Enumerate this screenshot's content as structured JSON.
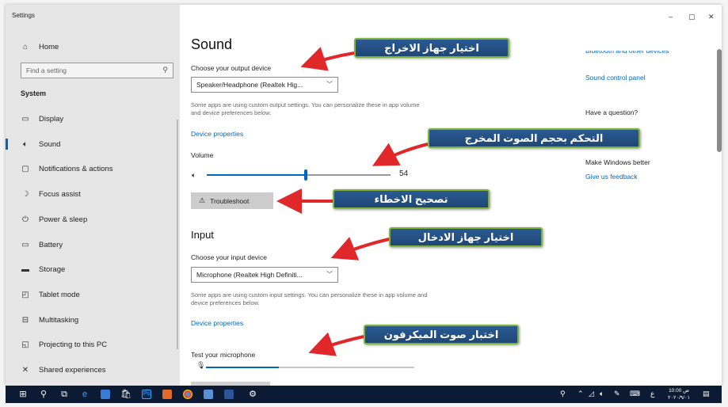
{
  "window": {
    "title": "Settings",
    "controls": {
      "minimize": "–",
      "maximize": "▢",
      "close": "✕"
    }
  },
  "sidebar": {
    "home": "Home",
    "search_placeholder": "Find a setting",
    "section": "System",
    "items": [
      {
        "label": "Display",
        "icon": "display-icon"
      },
      {
        "label": "Sound",
        "icon": "speaker-icon",
        "active": true
      },
      {
        "label": "Notifications & actions",
        "icon": "notification-icon"
      },
      {
        "label": "Focus assist",
        "icon": "moon-icon"
      },
      {
        "label": "Power & sleep",
        "icon": "power-icon"
      },
      {
        "label": "Battery",
        "icon": "battery-icon"
      },
      {
        "label": "Storage",
        "icon": "storage-icon"
      },
      {
        "label": "Tablet mode",
        "icon": "tablet-icon"
      },
      {
        "label": "Multitasking",
        "icon": "multitasking-icon"
      },
      {
        "label": "Projecting to this PC",
        "icon": "projector-icon"
      },
      {
        "label": "Shared experiences",
        "icon": "shared-icon"
      }
    ]
  },
  "main": {
    "title": "Sound",
    "output": {
      "label": "Choose your output device",
      "device": "Speaker/Headphone (Realtek Hig...",
      "note": "Some apps are using custom output settings. You can personalize these in app volume and device preferences below.",
      "properties_link": "Device properties",
      "volume_label": "Volume",
      "volume_value": "54",
      "volume_fraction": 0.54,
      "troubleshoot": "Troubleshoot"
    },
    "input": {
      "heading": "Input",
      "label": "Choose your input device",
      "device": "Microphone (Realtek High Definiti...",
      "note": "Some apps are using custom input settings. You can personalize these in app volume and device preferences below.",
      "properties_link": "Device properties",
      "test_label": "Test your microphone",
      "mic_level_fraction": 0.35
    }
  },
  "related": {
    "cut_link": "Bluetooth and other devices",
    "sound_control_panel": "Sound control panel",
    "question": "Have a question?",
    "make_better": "Make Windows better",
    "feedback": "Give us feedback"
  },
  "annotations": {
    "output_device": "اختيار جهاز الاخراج",
    "volume": "التحكم بحجم الصوت المخرج",
    "troubleshoot": "تصحيح الاخطاء",
    "input_device": "اختيار جهاز الادخال",
    "microphone": "اختبار صوت الميكرفون",
    "callout_border": "#7fb23a",
    "callout_bg": "#1f4775",
    "arrow_color": "#e0272a"
  },
  "taskbar": {
    "clock_time": "10:00 ص",
    "clock_date": "٢٠٢٠/٩/٠١",
    "lang": "ع",
    "ps_label": "Ps"
  },
  "colors": {
    "accent": "#0067c0",
    "sidebar_bg": "#e6e6e6",
    "taskbar_bg": "#0d1a33"
  }
}
